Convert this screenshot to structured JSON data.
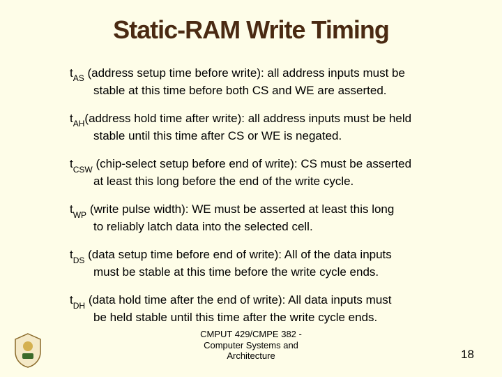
{
  "title": "Static-RAM Write Timing",
  "params": [
    {
      "sub": "AS",
      "label": "(address setup time before write):",
      "desc_first": " all address inputs must be",
      "desc_rest": "stable at this time before both CS and WE are asserted."
    },
    {
      "sub": "AH",
      "label": "(address hold time after write):",
      "desc_first": " all address inputs must be held",
      "desc_rest": "stable until this time after CS or WE is negated."
    },
    {
      "sub": "CSW",
      "label": "(chip-select setup before end of write):",
      "desc_first": " CS must be asserted",
      "desc_rest": "at least this long before the end of the write cycle."
    },
    {
      "sub": "WP",
      "label": "(write pulse width):",
      "desc_first": " WE must be asserted at least this long",
      "desc_rest": "to reliably latch data into the selected cell."
    },
    {
      "sub": "DS",
      "label": "(data setup time before end of write):",
      "desc_first": " All of the data inputs",
      "desc_rest": "must be stable at this time before the write cycle ends."
    },
    {
      "sub": "DH",
      "label": "(data hold time after the end of write):",
      "desc_first": " All data inputs must",
      "desc_rest": "be held stable until this time after the write cycle ends."
    }
  ],
  "footer": {
    "line1": "CMPUT 429/CMPE 382 -",
    "line2": "Computer Systems and",
    "line3": "Architecture"
  },
  "pagenum": "18"
}
